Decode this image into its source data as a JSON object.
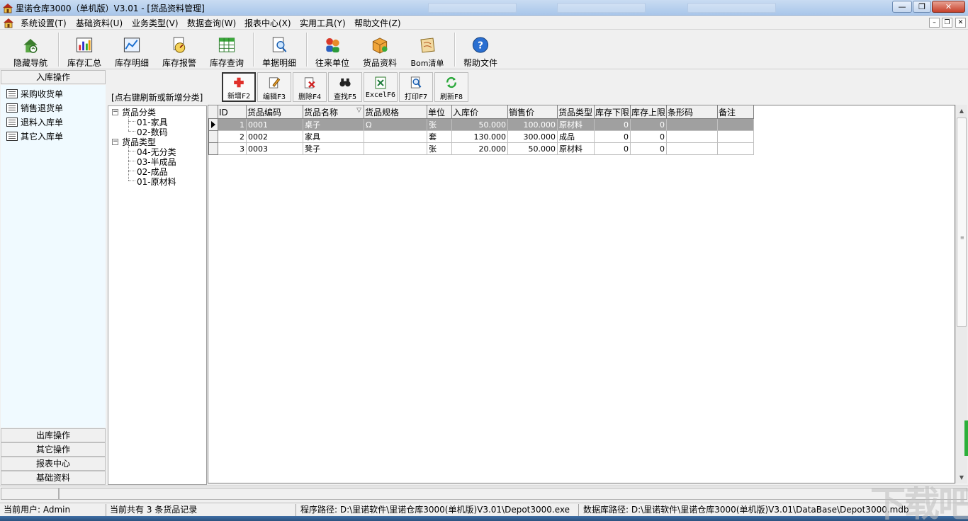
{
  "window": {
    "title": "里诺仓库3000（单机版）V3.01 - [货品资料管理]",
    "minimize_label": "—",
    "restore_label": "❐",
    "close_label": "✕"
  },
  "menu": {
    "items": [
      "系统设置(T)",
      "基础资料(U)",
      "业务类型(V)",
      "数据查询(W)",
      "报表中心(X)",
      "实用工具(Y)",
      "帮助文件(Z)"
    ],
    "mdi_minimize": "–",
    "mdi_restore": "❐",
    "mdi_close": "✕"
  },
  "toolbar": {
    "items": [
      "隐藏导航",
      "库存汇总",
      "库存明细",
      "库存报警",
      "库存查询",
      "单据明细",
      "往来单位",
      "货品资料",
      "Bom清单",
      "帮助文件"
    ]
  },
  "nav": {
    "active_section": "入库操作",
    "items": [
      "采购收货单",
      "销售退货单",
      "退料入库单",
      "其它入库单"
    ],
    "sections": [
      "出库操作",
      "其它操作",
      "报表中心",
      "基础资料"
    ]
  },
  "tree": {
    "hint": "[点右键刷新或新增分类]",
    "groups": [
      {
        "label": "货品分类",
        "children": [
          "01-家具",
          "02-数码"
        ]
      },
      {
        "label": "货品类型",
        "children": [
          "04-无分类",
          "03-半成品",
          "02-成品",
          "01-原材料"
        ]
      }
    ],
    "toggle": "−"
  },
  "grid_toolbar": {
    "buttons": [
      "新增F2",
      "编辑F3",
      "删除F4",
      "查找F5",
      "ExcelF6",
      "打印F7",
      "刷新F8"
    ]
  },
  "grid": {
    "columns": [
      "ID",
      "货品编码",
      "货品名称",
      "货品规格",
      "单位",
      "入库价",
      "销售价",
      "货品类型",
      "库存下限",
      "库存上限",
      "条形码",
      "备注"
    ],
    "sort_indicator": "▽",
    "rows": [
      {
        "id": "1",
        "code": "0001",
        "name": "桌子",
        "spec": "Ω",
        "unit": "张",
        "in_price": "50.000",
        "sale_price": "100.000",
        "type": "原材料",
        "min": "0",
        "max": "0",
        "barcode": "",
        "note": ""
      },
      {
        "id": "2",
        "code": "0002",
        "name": "家具",
        "spec": "",
        "unit": "套",
        "in_price": "130.000",
        "sale_price": "300.000",
        "type": "成品",
        "min": "0",
        "max": "0",
        "barcode": "",
        "note": ""
      },
      {
        "id": "3",
        "code": "0003",
        "name": "凳子",
        "spec": "",
        "unit": "张",
        "in_price": "20.000",
        "sale_price": "50.000",
        "type": "原材料",
        "min": "0",
        "max": "0",
        "barcode": "",
        "note": ""
      }
    ]
  },
  "status": {
    "user": "当前用户: Admin",
    "record_count": "当前共有 3 条货品记录",
    "program_path": "程序路径: D:\\里诺软件\\里诺仓库3000(单机版)V3.01\\Depot3000.exe",
    "db_path": "数据库路径: D:\\里诺软件\\里诺仓库3000(单机版)V3.01\\DataBase\\Depot3000.mdb"
  },
  "scroll": {
    "up": "▲",
    "down": "▼",
    "grip": "≡"
  },
  "watermark": "下载吧",
  "colors": {
    "selected_row": "#a0a0a0",
    "nav_panel": "#f0faff",
    "title_bar": "#b9d1ee"
  }
}
